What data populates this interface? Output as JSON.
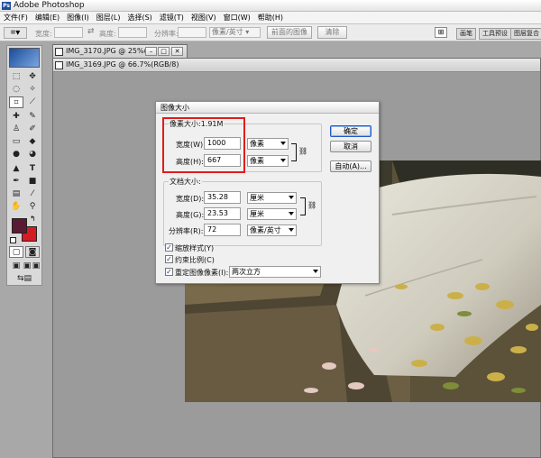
{
  "app": {
    "title": "Adobe Photoshop",
    "icon": "photoshop-icon"
  },
  "menu": [
    "文件(F)",
    "编辑(E)",
    "图像(I)",
    "图层(L)",
    "选择(S)",
    "滤镜(T)",
    "视图(V)",
    "窗口(W)",
    "帮助(H)"
  ],
  "options": {
    "width_label": "宽度:",
    "height_label": "高度:",
    "resolution_label": "分辨率:",
    "unit_value": "像素/英寸",
    "front_image_button": "前面的图像",
    "clear_button": "清除",
    "panel_tabs": [
      "画笔",
      "工具预设",
      "图层复合"
    ]
  },
  "documents": [
    {
      "title": "IMG_3170.JPG @ 25%(..."
    },
    {
      "title": "IMG_3169.JPG @ 66.7%(RGB/8)"
    }
  ],
  "colors": {
    "foreground": "#5a1a33",
    "background": "#d31c24",
    "highlight": "#e31b1b",
    "ok_border": "#1e5ac8"
  },
  "dialog": {
    "title": "图像大小",
    "pixel_dimensions": {
      "legend": "像素大小:1.91M",
      "width_label": "宽度(W):",
      "width_value": "1000",
      "width_unit": "像素",
      "height_label": "高度(H):",
      "height_value": "667",
      "height_unit": "像素"
    },
    "document_size": {
      "legend": "文档大小:",
      "width_label": "宽度(D):",
      "width_value": "35.28",
      "width_unit": "厘米",
      "height_label": "高度(G):",
      "height_value": "23.53",
      "height_unit": "厘米",
      "resolution_label": "分辨率(R):",
      "resolution_value": "72",
      "resolution_unit": "像素/英寸"
    },
    "checkboxes": {
      "scale_styles": {
        "label": "缩放样式(Y)",
        "checked": true
      },
      "constrain_proportions": {
        "label": "约束比例(C)",
        "checked": true
      },
      "resample": {
        "label": "重定图像像素(I):",
        "checked": true
      }
    },
    "resample_method": "两次立方",
    "buttons": {
      "ok": "确定",
      "cancel": "取消",
      "auto": "自动(A)..."
    }
  }
}
